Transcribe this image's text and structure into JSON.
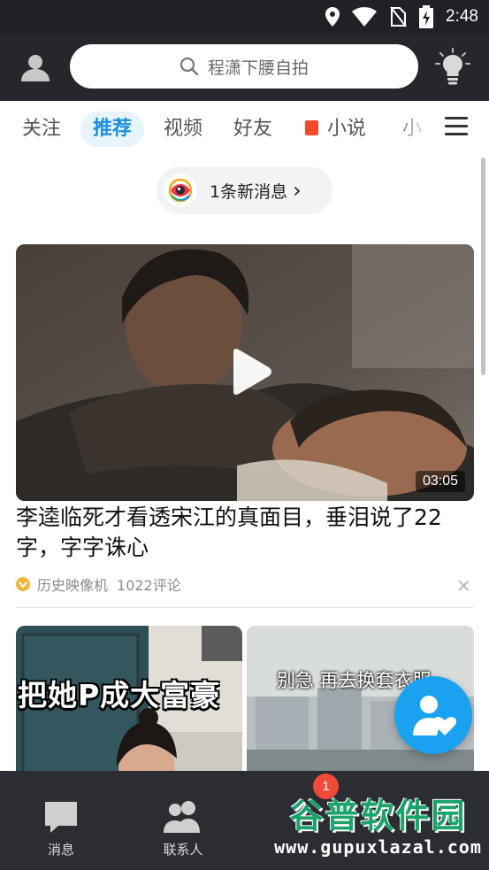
{
  "status_bar": {
    "time": "2:48"
  },
  "header": {
    "search_placeholder": "程潇下腰自拍"
  },
  "tabs": [
    {
      "label": "关注"
    },
    {
      "label": "推荐"
    },
    {
      "label": "视频"
    },
    {
      "label": "好友"
    },
    {
      "label": "小说"
    },
    {
      "label": "小"
    }
  ],
  "news_pill": {
    "label": "1条新消息",
    "chevron": "›"
  },
  "article": {
    "duration": "03:05",
    "title": "李逵临死才看透宋江的真面目，垂泪说了22字，字字诛心",
    "source": "历史映像机",
    "comments": "1022评论",
    "dismiss": "✕"
  },
  "thumbnails": [
    {
      "caption": "把她P成大富豪"
    },
    {
      "caption": "别急 再去换套衣服"
    }
  ],
  "bottom_nav": [
    {
      "label": "消息",
      "icon": "chat-icon"
    },
    {
      "label": "联系人",
      "icon": "contacts-icon"
    }
  ],
  "badge": {
    "count": "1"
  },
  "watermark": {
    "title": "谷普软件园",
    "url": "www.gupuxlazal.com"
  },
  "colors": {
    "accent": "#1f8fdd",
    "fab": "#1aa1f0",
    "badge": "#f04a3a",
    "dark_bar": "#25272c"
  }
}
